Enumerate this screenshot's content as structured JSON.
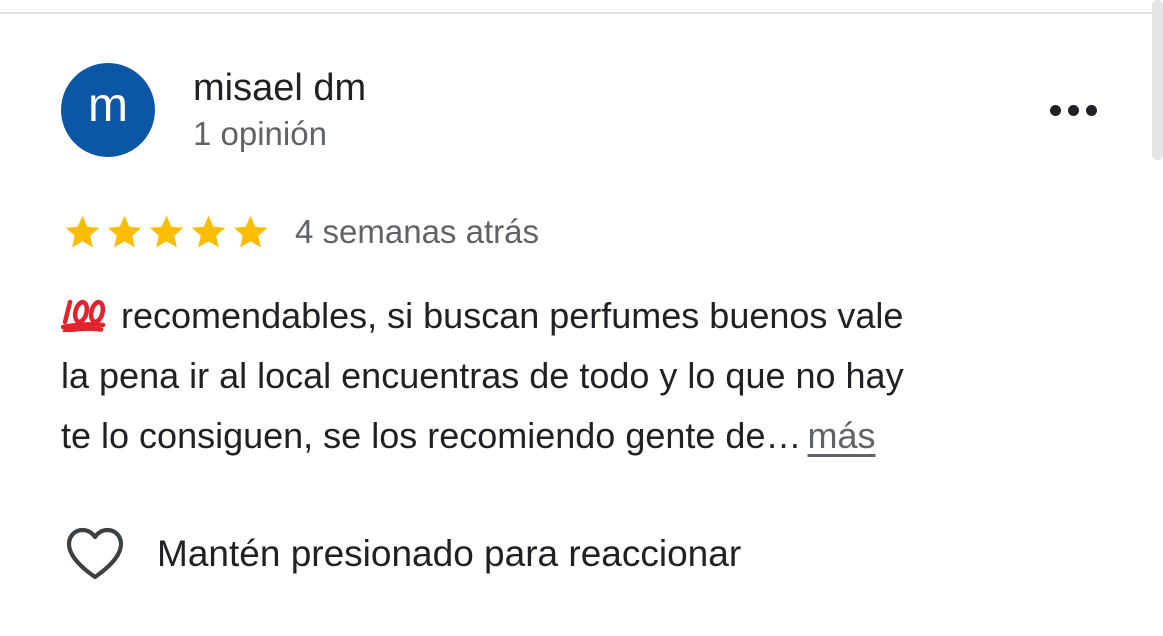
{
  "review": {
    "author": {
      "initial": "m",
      "name": "misael dm",
      "meta": "1 opinión",
      "avatar_color": "#0b57a6"
    },
    "menu_icon": "more-horiz-icon",
    "rating": {
      "stars": 5,
      "max": 5,
      "color": "#fbbc04"
    },
    "date": "4 semanas atrás",
    "text": {
      "emoji_icon": "hundred-points-icon",
      "line1": "recomendables, si buscan perfumes buenos vale",
      "line2": "la pena ir al local encuentras de todo y lo que no hay",
      "line3": "te lo consiguen, se los recomiendo gente de…",
      "more_label": "más"
    },
    "reaction": {
      "icon": "heart-outline-icon",
      "label": "Mantén presionado para reaccionar"
    }
  }
}
